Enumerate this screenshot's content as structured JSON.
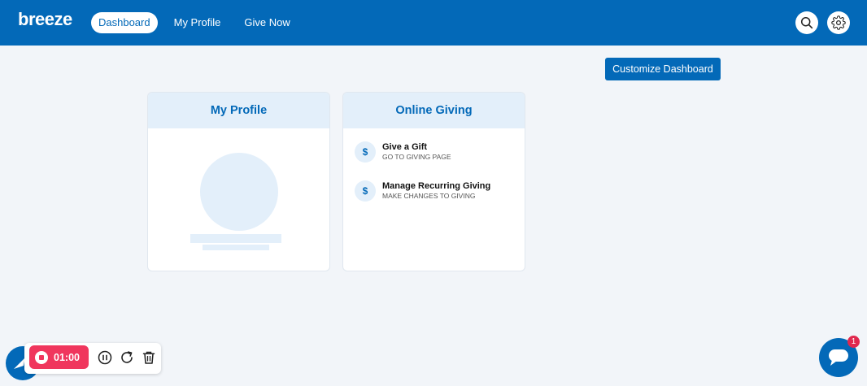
{
  "app": {
    "logo": "breeze"
  },
  "nav": {
    "items": [
      {
        "label": "Dashboard",
        "active": true
      },
      {
        "label": "My Profile",
        "active": false
      },
      {
        "label": "Give Now",
        "active": false
      }
    ]
  },
  "header": {
    "search_icon": "search-icon",
    "settings_icon": "gear-icon"
  },
  "toolbar": {
    "customize_label": "Customize Dashboard"
  },
  "profile_card": {
    "title": "My Profile"
  },
  "giving_card": {
    "title": "Online Giving",
    "items": [
      {
        "icon": "$",
        "title": "Give a Gift",
        "subtitle": "GO TO GIVING PAGE"
      },
      {
        "icon": "$",
        "title": "Manage Recurring Giving",
        "subtitle": "MAKE CHANGES TO GIVING"
      }
    ]
  },
  "recorder": {
    "time": "01:00"
  },
  "chat": {
    "badge": "1"
  },
  "colors": {
    "brand": "#0369b8",
    "card_header": "#e3effa",
    "recorder": "#f0365d",
    "badge": "#e0284e"
  }
}
